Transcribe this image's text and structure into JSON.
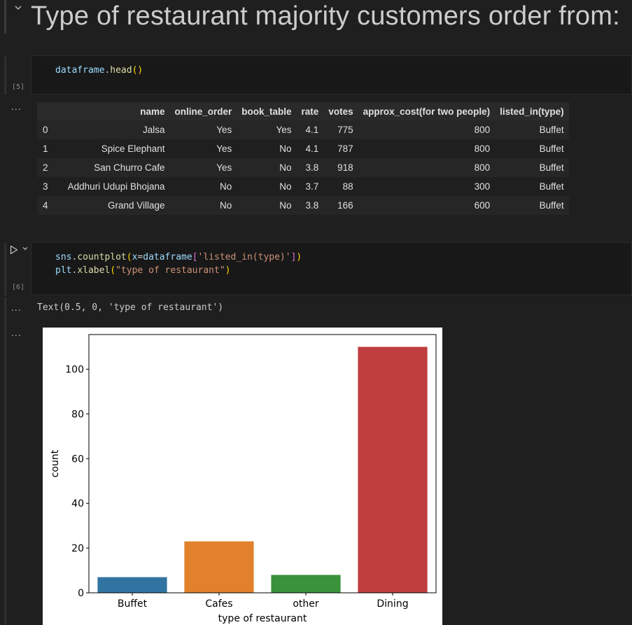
{
  "markdown_cell": {
    "heading": "Type of restaurant majority customers order from:"
  },
  "cell_5": {
    "exec_count": "[5]",
    "code_var": "dataframe",
    "code_dot": ".",
    "code_fn": "head",
    "code_paren": "()"
  },
  "output_5": {
    "dots": "...",
    "columns": [
      "",
      "name",
      "online_order",
      "book_table",
      "rate",
      "votes",
      "approx_cost(for two people)",
      "listed_in(type)"
    ],
    "rows": [
      [
        "0",
        "Jalsa",
        "Yes",
        "Yes",
        "4.1",
        "775",
        "800",
        "Buffet"
      ],
      [
        "1",
        "Spice Elephant",
        "Yes",
        "No",
        "4.1",
        "787",
        "800",
        "Buffet"
      ],
      [
        "2",
        "San Churro Cafe",
        "Yes",
        "No",
        "3.8",
        "918",
        "800",
        "Buffet"
      ],
      [
        "3",
        "Addhuri Udupi Bhojana",
        "No",
        "No",
        "3.7",
        "88",
        "300",
        "Buffet"
      ],
      [
        "4",
        "Grand Village",
        "No",
        "No",
        "3.8",
        "166",
        "600",
        "Buffet"
      ]
    ]
  },
  "cell_6": {
    "exec_count": "[6]",
    "line1": {
      "var": "sns",
      "dot": ".",
      "fn": "countplot",
      "open": "(",
      "arg": "x",
      "eq": "=",
      "df": "dataframe",
      "lb": "[",
      "str": "'listed_in(type)'",
      "rb": "]",
      "close": ")"
    },
    "line2": {
      "var": "plt",
      "dot": ".",
      "fn": "xlabel",
      "open": "(",
      "str": "\"type of restaurant\"",
      "close": ")"
    }
  },
  "output_6": {
    "dots_text": "...",
    "text": "Text(0.5, 0, 'type of restaurant')",
    "dots_plot": "..."
  },
  "chart_data": {
    "type": "bar",
    "categories": [
      "Buffet",
      "Cafes",
      "other",
      "Dining"
    ],
    "values": [
      7,
      23,
      8,
      110
    ],
    "colors": [
      "#3274a1",
      "#e1812c",
      "#3a923a",
      "#c03d3e"
    ],
    "xlabel": "type of restaurant",
    "ylabel": "count",
    "ylim": [
      0,
      115.5
    ],
    "yticks": [
      0,
      20,
      40,
      60,
      80,
      100
    ],
    "grid": false
  }
}
